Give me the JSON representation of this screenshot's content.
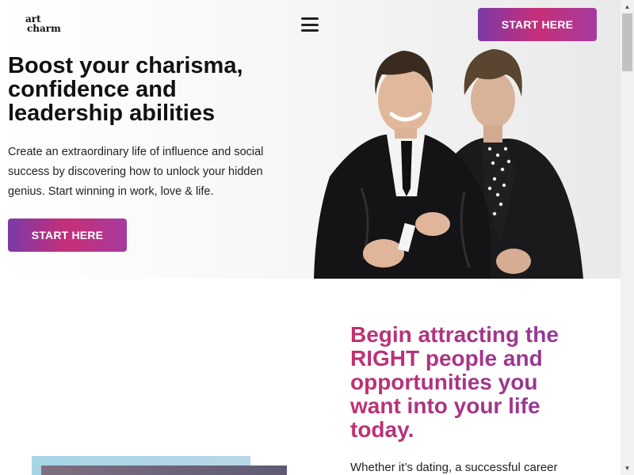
{
  "header": {
    "logo_line1": "art",
    "logo_line2": "charm",
    "menu_icon": "hamburger-menu-icon",
    "cta_label": "START HERE"
  },
  "hero": {
    "title": "Boost your charisma, confidence and leadership abilities",
    "text": "Create an extraordinary life of influence and social success by discovering how to unlock your hidden genius. Start winning in work, love & life.",
    "cta_label": "START HERE",
    "image_label": "Two presenters, one in a black leather jacket and one in a polka-dot shirt"
  },
  "section2": {
    "title": "Begin attracting the RIGHT people and opportunities you want into your life today.",
    "text": "Whether it’s dating, a successful career"
  },
  "scrollbar": {
    "up_icon": "scroll-up-arrow-icon",
    "down_icon": "scroll-down-arrow-icon"
  },
  "colors": {
    "accent_start": "#7b3aa8",
    "accent_mid": "#c62f78",
    "heading_pink": "#c2306f",
    "heading_purple": "#8a3a9e"
  }
}
